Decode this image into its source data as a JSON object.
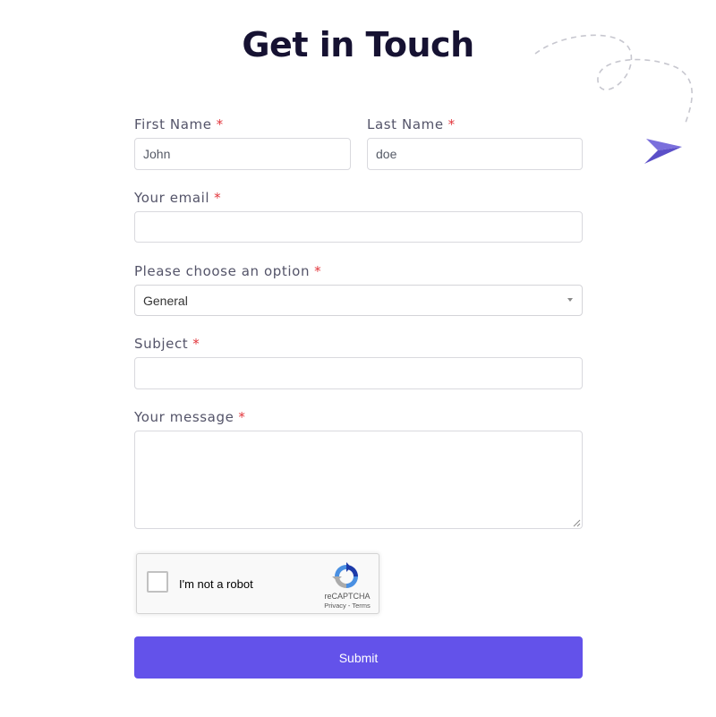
{
  "form": {
    "title": "Get in Touch",
    "required_marker": "*",
    "first_name": {
      "label": "First Name",
      "value": "John"
    },
    "last_name": {
      "label": "Last Name",
      "value": "doe"
    },
    "email": {
      "label": "Your email",
      "value": ""
    },
    "option": {
      "label": "Please choose an option",
      "selected": "General"
    },
    "subject": {
      "label": "Subject",
      "value": ""
    },
    "message": {
      "label": "Your message",
      "value": ""
    },
    "captcha": {
      "label": "I'm not a robot",
      "checked": false,
      "brand": "reCAPTCHA",
      "privacy": "Privacy",
      "separator": " - ",
      "terms": "Terms"
    },
    "submit_label": "Submit"
  },
  "icons": {
    "decoration": "paper-plane-icon",
    "select_caret": "chevron-down-icon",
    "captcha_logo": "recaptcha-icon"
  },
  "colors": {
    "title": "#161232",
    "label": "#545469",
    "required": "#e2363c",
    "accent": "#6352ea",
    "plane": "#5b4fc8"
  }
}
